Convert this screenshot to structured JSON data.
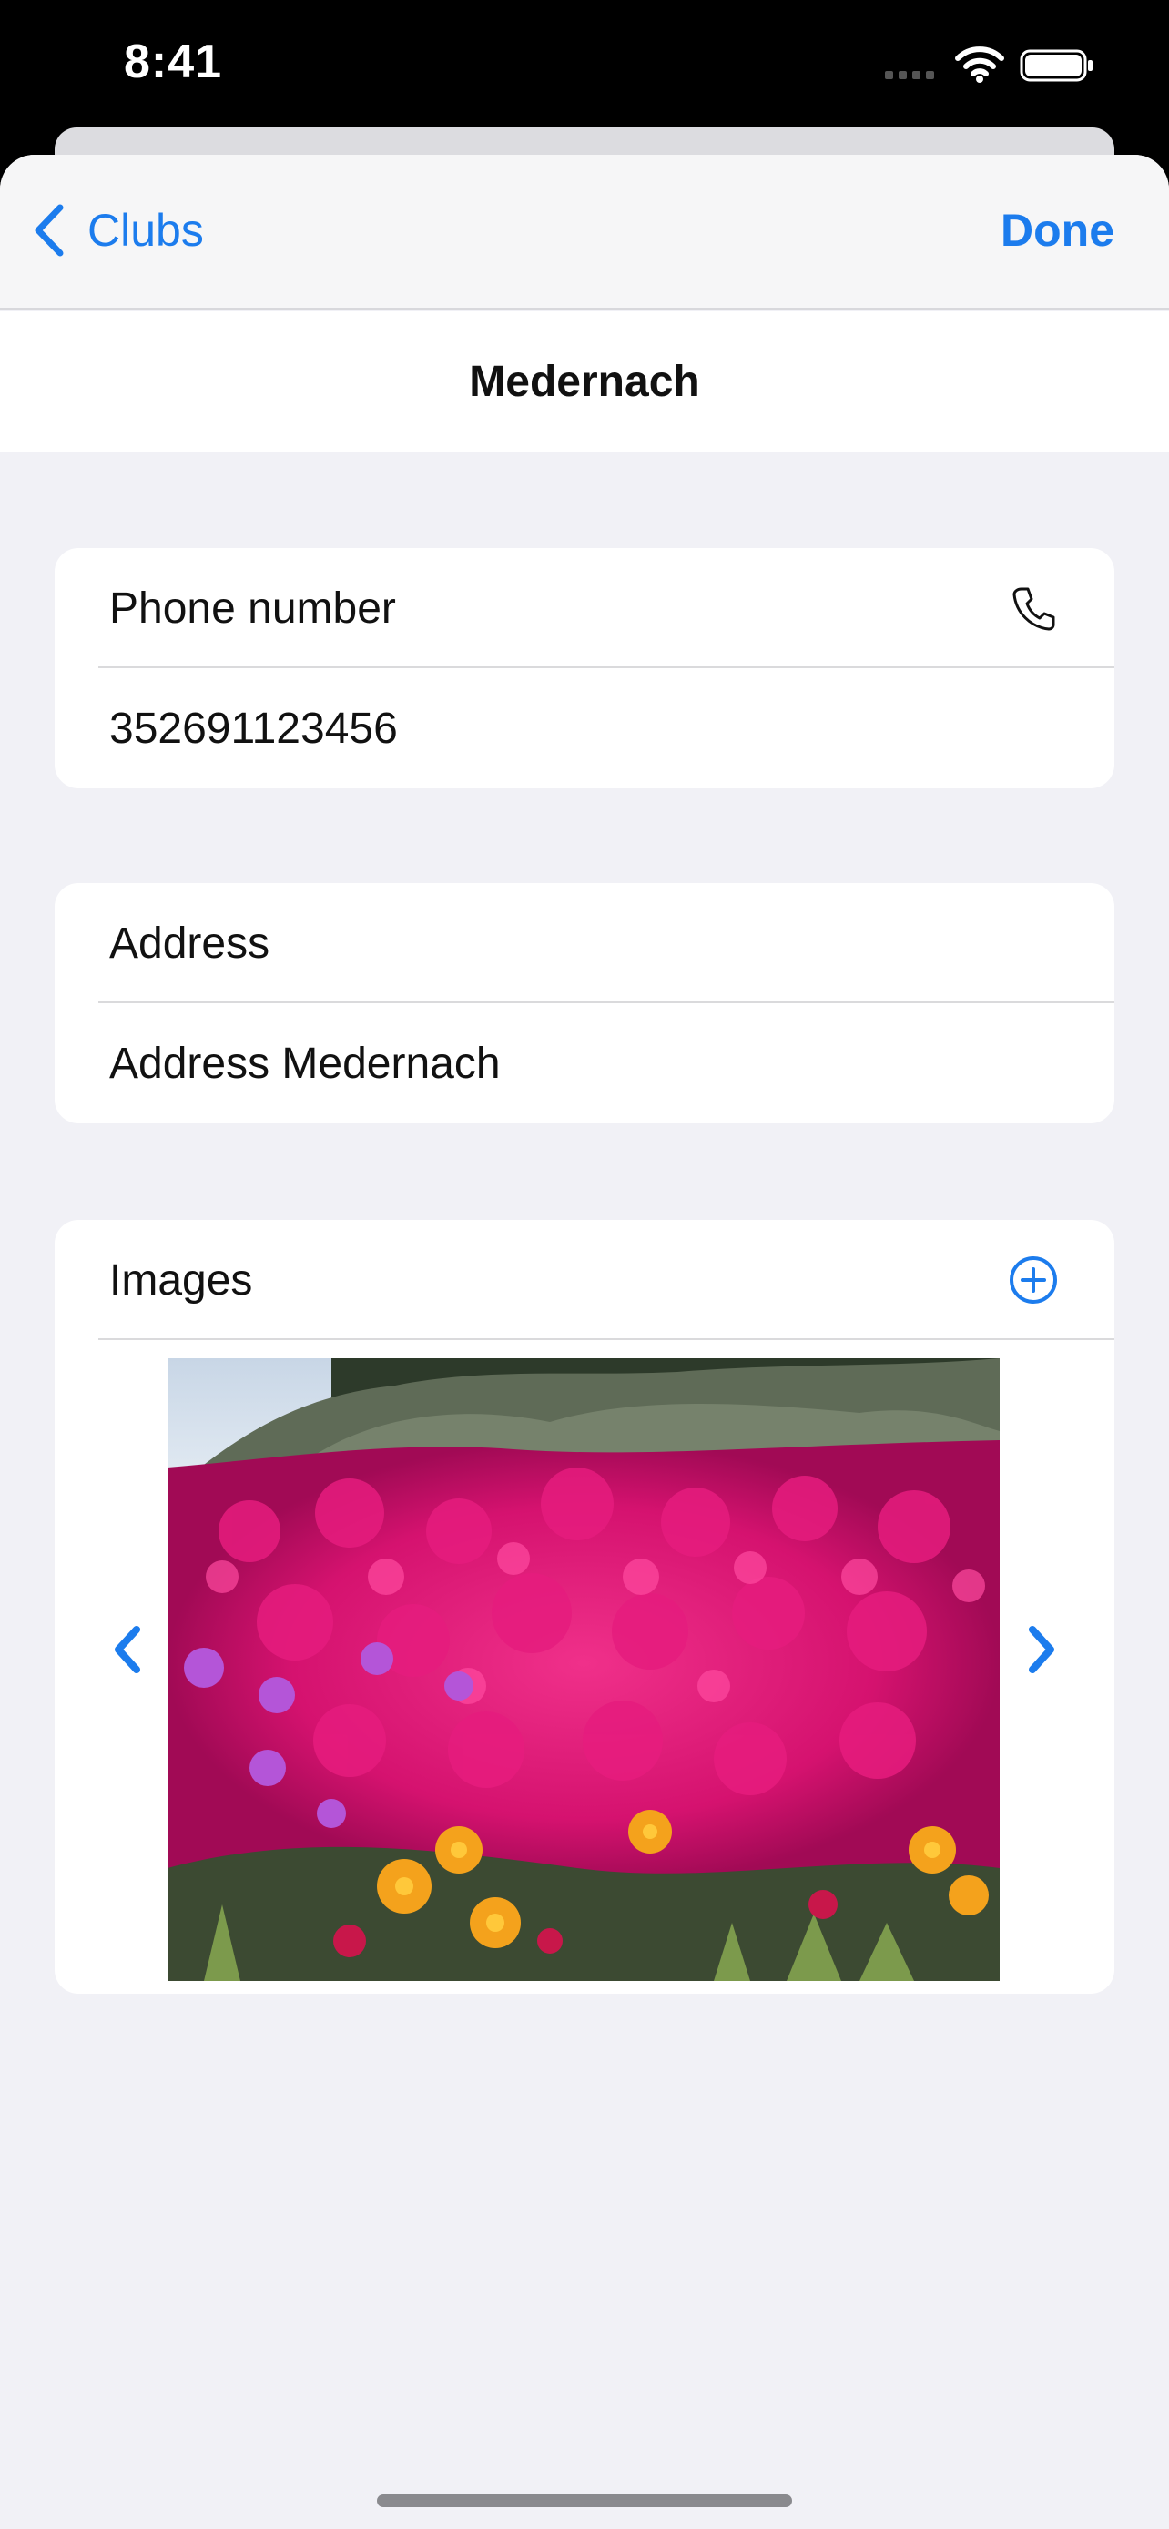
{
  "status_bar": {
    "time": "8:41"
  },
  "nav": {
    "back_label": "Clubs",
    "done_label": "Done"
  },
  "title": "Medernach",
  "phone": {
    "label": "Phone number",
    "value": "352691123456"
  },
  "address": {
    "label": "Address",
    "value": "Address Medernach"
  },
  "images": {
    "label": "Images"
  },
  "colors": {
    "accent": "#1c7ced",
    "background": "#f1f1f6"
  }
}
